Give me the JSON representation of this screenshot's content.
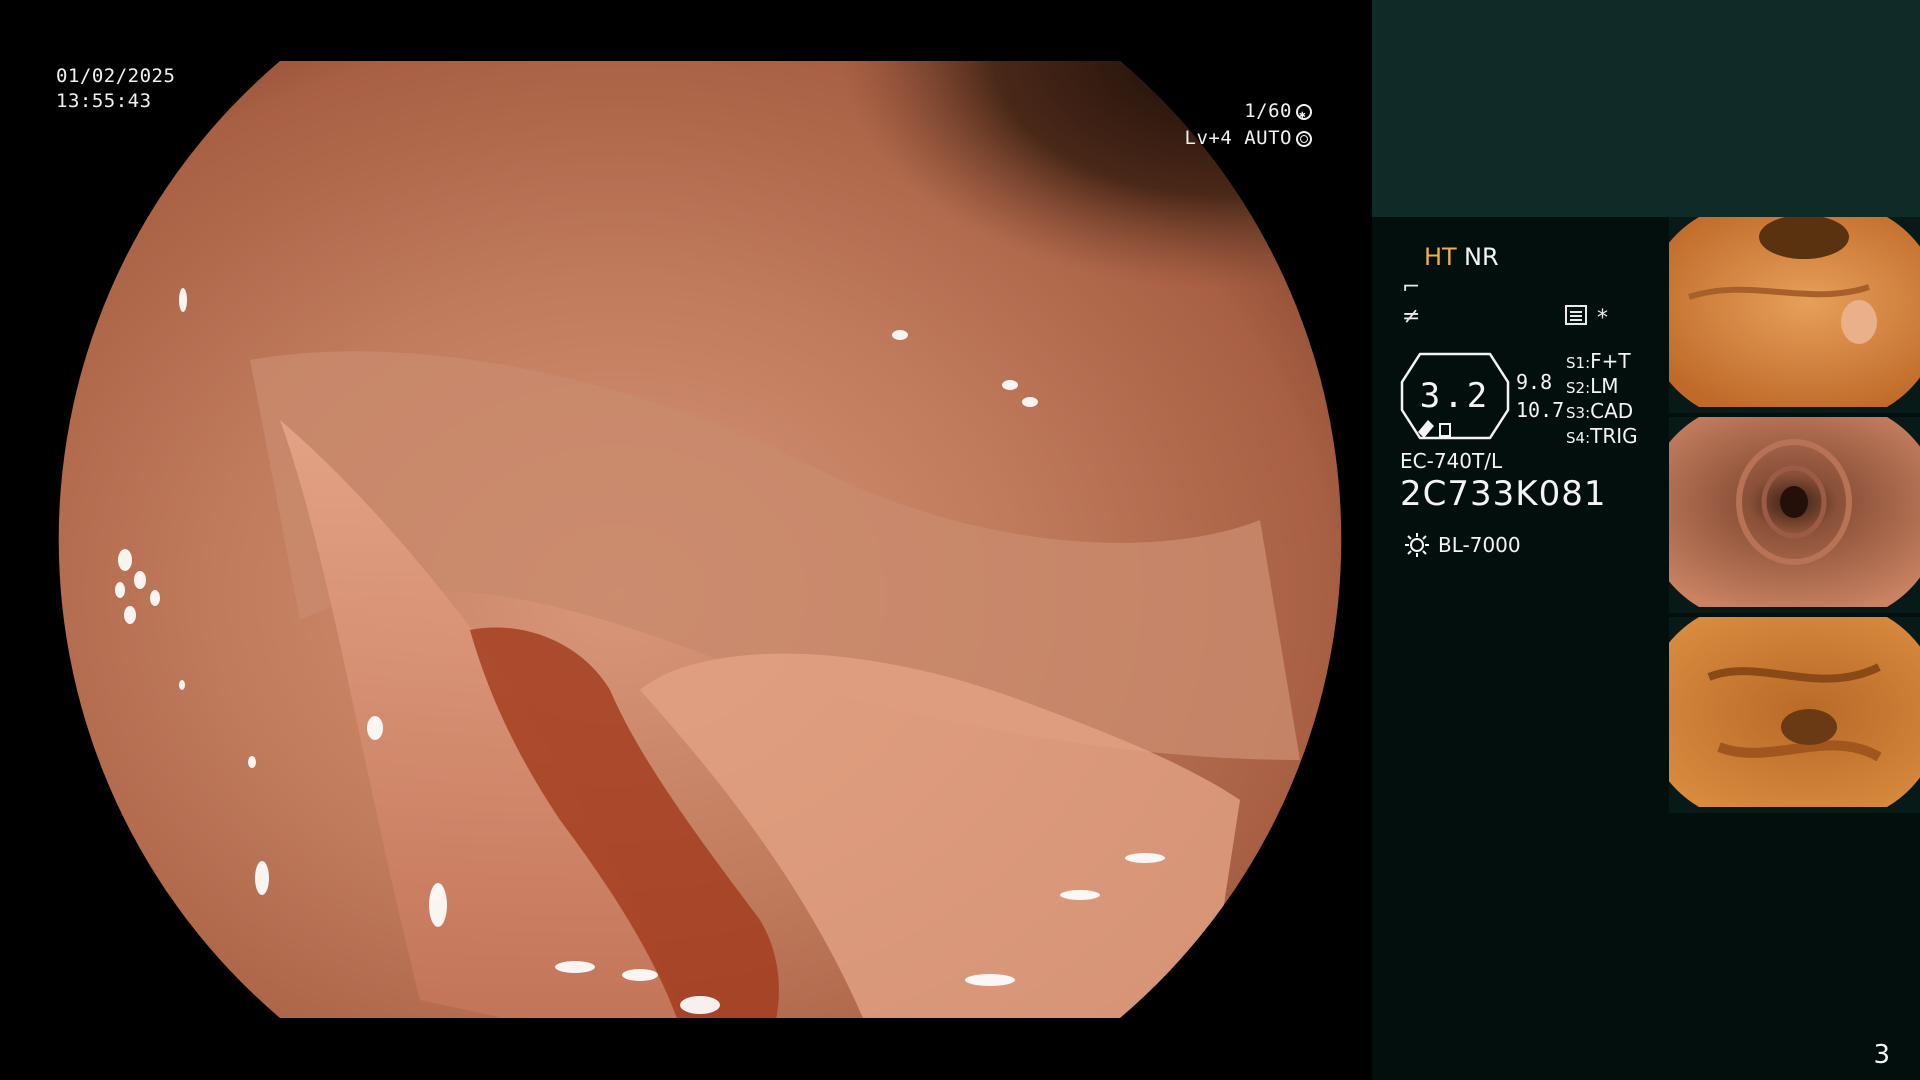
{
  "overlay": {
    "date": "01/02/2025",
    "time": "13:55:43",
    "shutter": "1/60",
    "exposure": "Lv+4 AUTO"
  },
  "sidebar": {
    "mode_ht": "HT",
    "mode_nr": "NR",
    "scope_number": "3.2",
    "diameter_1": "9.8",
    "diameter_2": "10.7",
    "switches": [
      {
        "key": "S1:",
        "value": "F+T"
      },
      {
        "key": "S2:",
        "value": "LM"
      },
      {
        "key": "S3:",
        "value": "CAD"
      },
      {
        "key": "S4:",
        "value": "TRIG"
      }
    ],
    "scope_model": "EC-740T/L",
    "scope_serial": "2C733K081",
    "light_source": "BL-7000",
    "asterisk": "*"
  },
  "thumbnails": [
    {
      "label": "thumbnail-1"
    },
    {
      "label": "thumbnail-2"
    },
    {
      "label": "thumbnail-3"
    }
  ],
  "page_number": "3",
  "colors": {
    "sidebar_bg": "#030f0d",
    "sidebar_top_bg": "#0e2b28",
    "ht_color": "#f0b040",
    "tissue": "#b86a4e"
  }
}
